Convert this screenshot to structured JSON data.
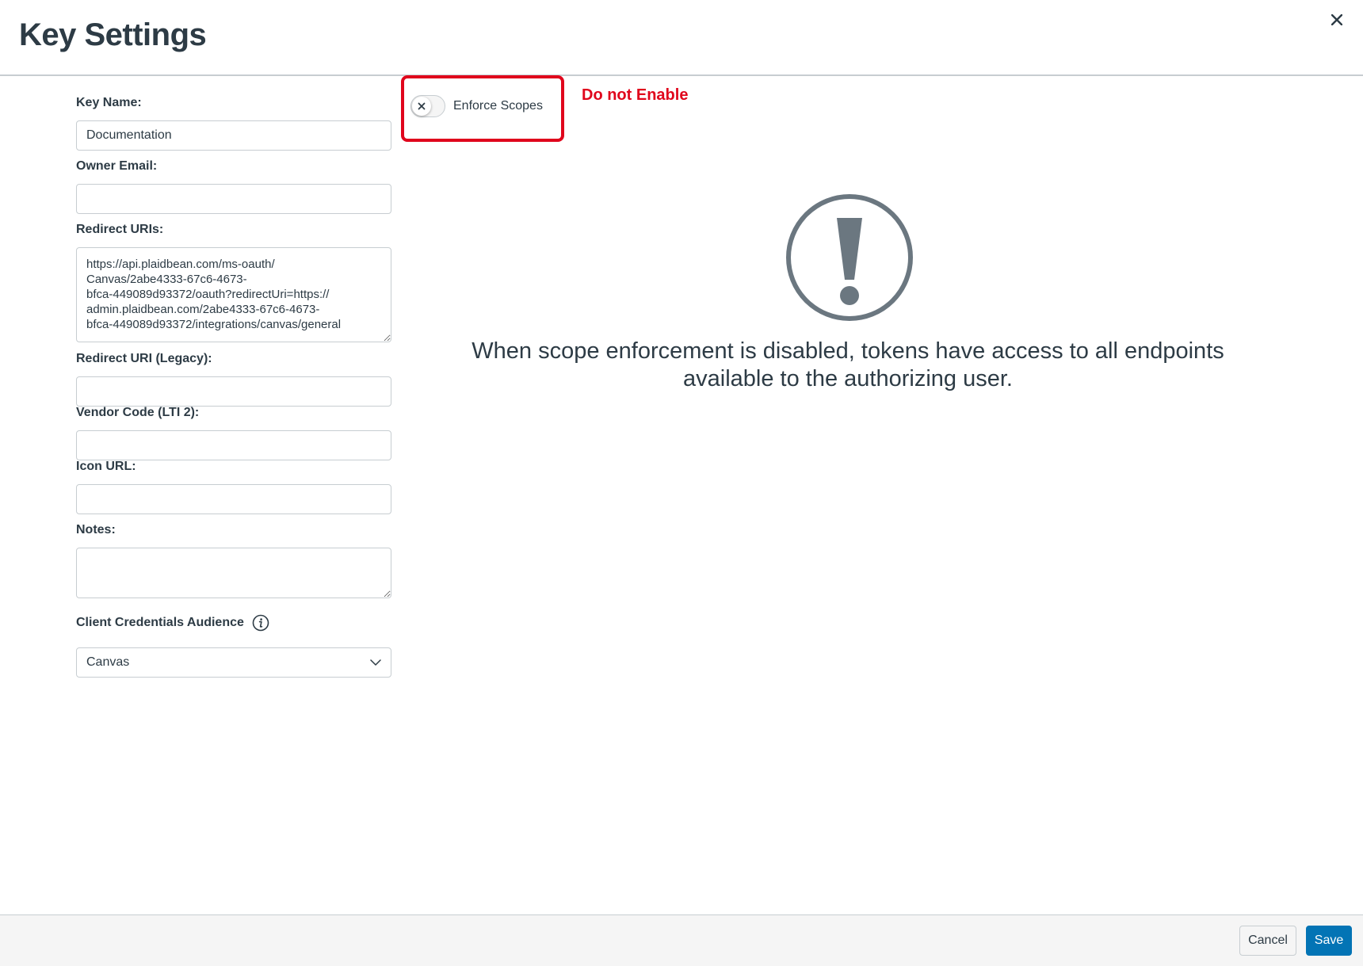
{
  "header": {
    "title": "Key Settings",
    "close_icon": "close-icon"
  },
  "form": {
    "key_name": {
      "label": "Key Name:",
      "value": "Documentation"
    },
    "owner_email": {
      "label": "Owner Email:",
      "value": ""
    },
    "redirect_uris": {
      "label": "Redirect URIs:",
      "value": "https://api.plaidbean.com/ms-oauth/\nCanvas/2abe4333-67c6-4673-\nbfca-449089d93372/oauth?redirectUri=https://\nadmin.plaidbean.com/2abe4333-67c6-4673-\nbfca-449089d93372/integrations/canvas/general"
    },
    "redirect_uri_legacy": {
      "label": "Redirect URI (Legacy):",
      "value": ""
    },
    "vendor_code": {
      "label": "Vendor Code (LTI 2):",
      "value": ""
    },
    "icon_url": {
      "label": "Icon URL:",
      "value": ""
    },
    "notes": {
      "label": "Notes:",
      "value": ""
    },
    "client_credentials_audience": {
      "label": "Client Credentials Audience",
      "selected": "Canvas",
      "icon": "info-icon"
    }
  },
  "scopes": {
    "toggle_label": "Enforce Scopes",
    "enabled": false,
    "annotation": "Do not Enable"
  },
  "warning": {
    "icon": "exclamation-circle-icon",
    "message": "When scope enforcement is disabled, tokens have access to all endpoints available to the authorizing user."
  },
  "footer": {
    "cancel_label": "Cancel",
    "save_label": "Save"
  },
  "colors": {
    "accent": "#0374b5",
    "annotation": "#e0061c",
    "text": "#2d3b45",
    "icon_gray": "#6b7780"
  }
}
